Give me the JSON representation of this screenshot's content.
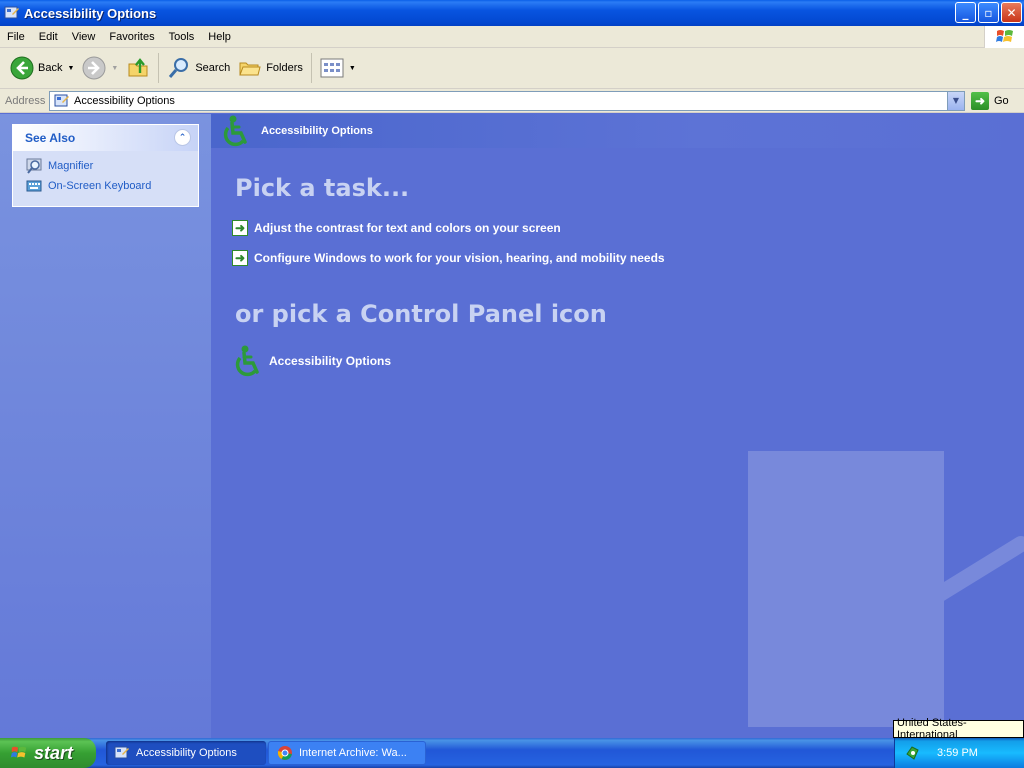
{
  "window": {
    "title": "Accessibility Options",
    "controls": {
      "minimize": "_",
      "maximize": "▫",
      "close": "✕"
    }
  },
  "menu": [
    "File",
    "Edit",
    "View",
    "Favorites",
    "Tools",
    "Help"
  ],
  "toolbar": {
    "back_label": "Back",
    "search_label": "Search",
    "folders_label": "Folders"
  },
  "address": {
    "label": "Address",
    "value": "Accessibility Options",
    "go_label": "Go"
  },
  "sidebar": {
    "see_also_title": "See Also",
    "links": [
      {
        "label": "Magnifier",
        "icon": "magnifier-icon"
      },
      {
        "label": "On-Screen Keyboard",
        "icon": "keyboard-icon"
      }
    ]
  },
  "main": {
    "header_title": "Accessibility Options",
    "pick_task_heading": "Pick a task...",
    "tasks": [
      "Adjust the contrast for text and colors on your screen",
      "Configure Windows to work for your vision, hearing, and mobility needs"
    ],
    "pick_icon_heading": "or pick a Control Panel icon",
    "icons": [
      "Accessibility Options"
    ]
  },
  "taskbar": {
    "start_label": "start",
    "items": [
      {
        "label": "Accessibility Options",
        "active": true
      },
      {
        "label": "Internet Archive: Wa...",
        "active": false
      }
    ],
    "clock": "3:59 PM",
    "language_tooltip": "United States-International"
  },
  "colors": {
    "titlebar": "#0854e0",
    "main_bg": "#5a6fd4",
    "link": "#215dc6",
    "start_green": "#36a033"
  }
}
